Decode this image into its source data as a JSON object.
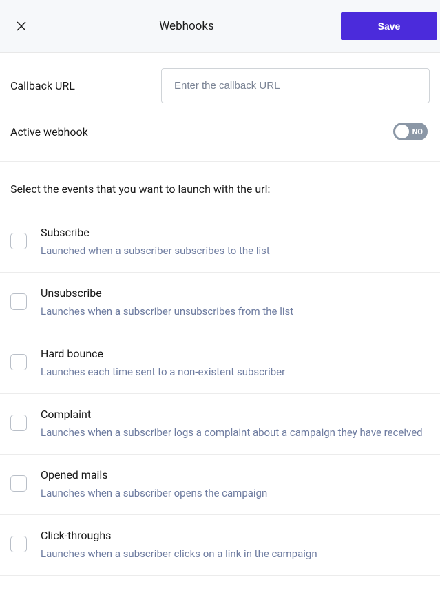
{
  "header": {
    "title": "Webhooks",
    "save_label": "Save"
  },
  "callback": {
    "label": "Callback URL",
    "placeholder": "Enter the callback URL",
    "value": ""
  },
  "active": {
    "label": "Active webhook",
    "state_label": "NO",
    "value": false
  },
  "events_heading": "Select the events that you want to launch with the url:",
  "events": [
    {
      "title": "Subscribe",
      "desc": "Launched when a subscriber subscribes to the list"
    },
    {
      "title": "Unsubscribe",
      "desc": "Launches when a subscriber unsubscribes from the list"
    },
    {
      "title": "Hard bounce",
      "desc": "Launches each time sent to a non-existent subscriber"
    },
    {
      "title": "Complaint",
      "desc": "Launches when a subscriber logs a complaint about a campaign they have received"
    },
    {
      "title": "Opened mails",
      "desc": "Launches when a subscriber opens the campaign"
    },
    {
      "title": "Click-throughs",
      "desc": "Launches when a subscriber clicks on a link in the campaign"
    }
  ]
}
